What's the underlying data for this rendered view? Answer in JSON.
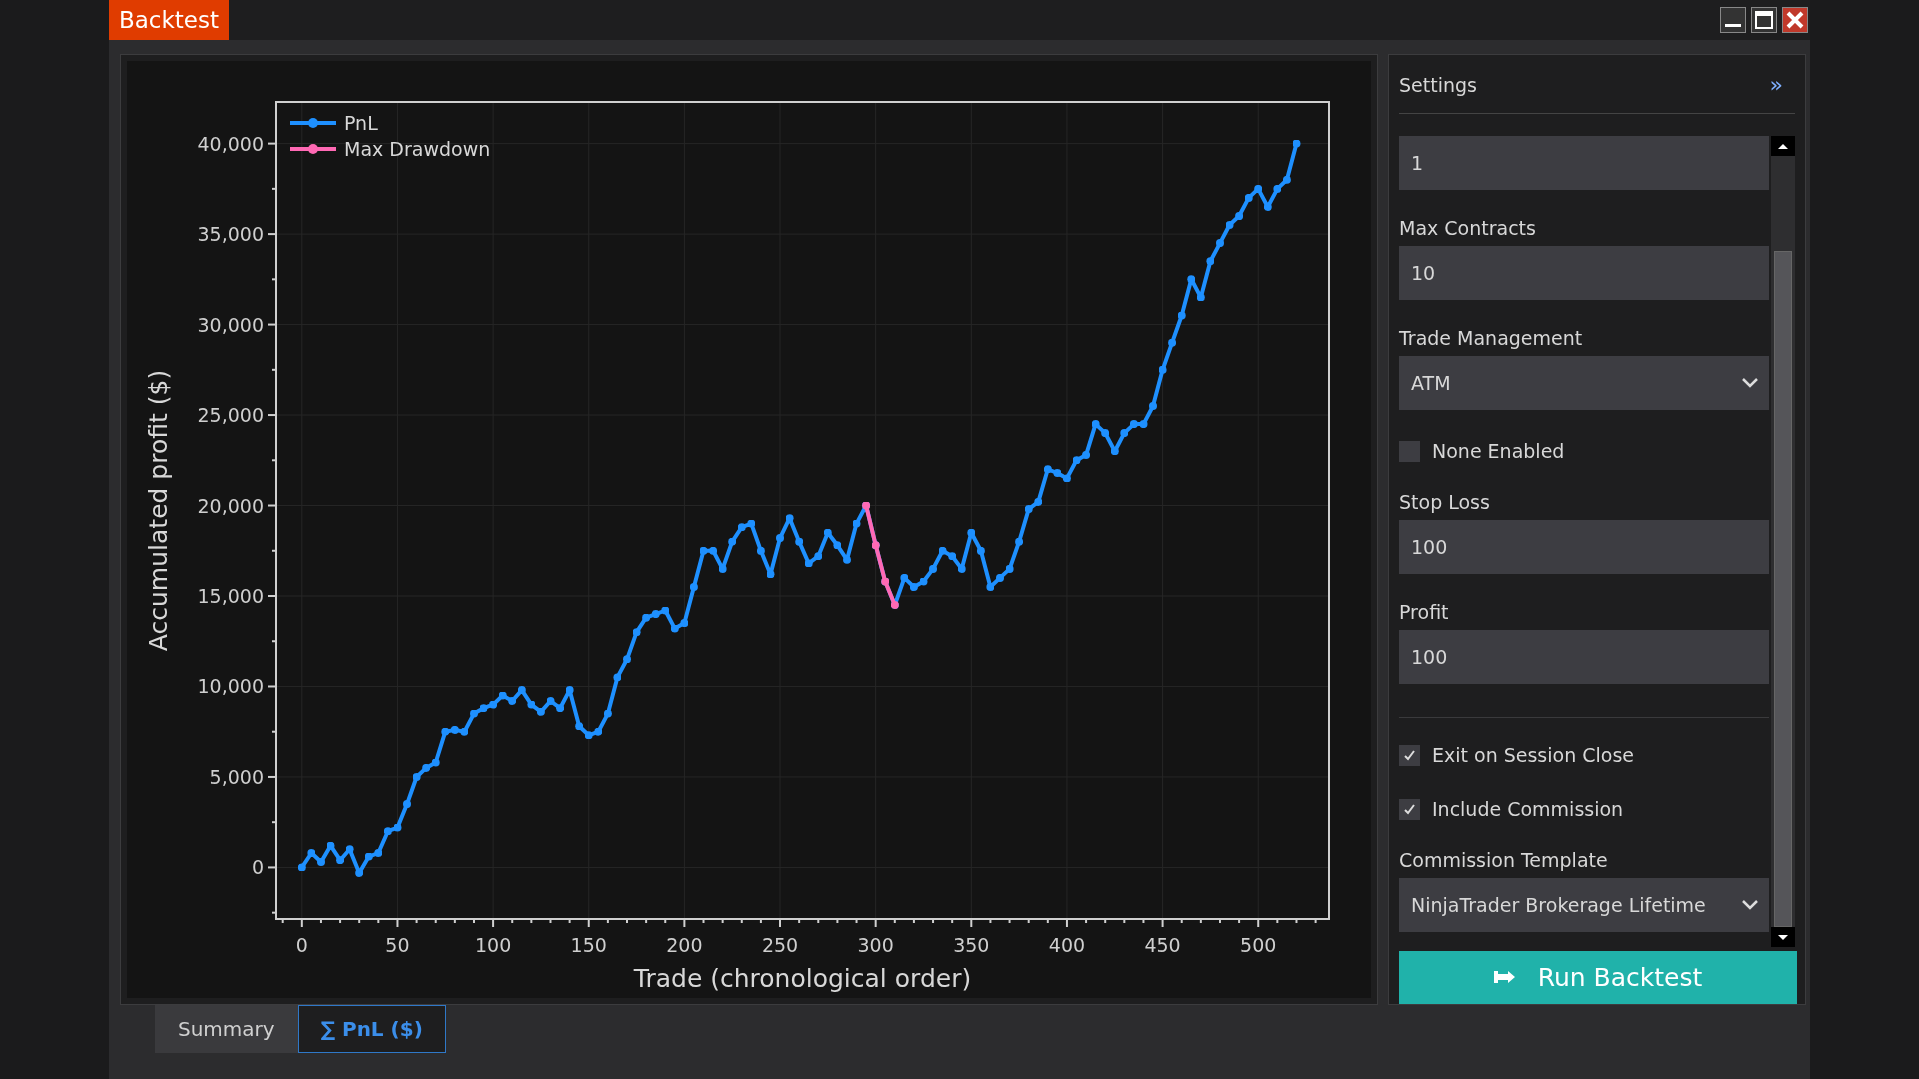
{
  "window": {
    "title": "Backtest"
  },
  "chart_panel": {
    "chart_data": {
      "type": "line",
      "grid": true,
      "legend": true,
      "xlabel": "Trade (chronological order)",
      "ylabel": "Accumulated profit ($)",
      "x": [
        0,
        5,
        10,
        15,
        20,
        25,
        30,
        35,
        40,
        45,
        50,
        55,
        60,
        65,
        70,
        75,
        80,
        85,
        90,
        95,
        100,
        105,
        110,
        115,
        120,
        125,
        130,
        135,
        140,
        145,
        150,
        155,
        160,
        165,
        170,
        175,
        180,
        185,
        190,
        195,
        200,
        205,
        210,
        215,
        220,
        225,
        230,
        235,
        240,
        245,
        250,
        255,
        260,
        265,
        270,
        275,
        280,
        285,
        290,
        295,
        300,
        305,
        310,
        315,
        320,
        325,
        330,
        335,
        340,
        345,
        350,
        355,
        360,
        365,
        370,
        375,
        380,
        385,
        390,
        395,
        400,
        405,
        410,
        415,
        420,
        425,
        430,
        435,
        440,
        445,
        450,
        455,
        460,
        465,
        470,
        475,
        480,
        485,
        490,
        495,
        500,
        505,
        510,
        515,
        520
      ],
      "series": [
        {
          "name": "PnL",
          "color": "#1e90ff",
          "values": [
            0,
            800,
            300,
            1200,
            400,
            1000,
            -300,
            600,
            800,
            2000,
            2200,
            3500,
            5000,
            5500,
            5800,
            7500,
            7600,
            7500,
            8500,
            8800,
            9000,
            9500,
            9200,
            9800,
            9000,
            8600,
            9200,
            8800,
            9800,
            7800,
            7300,
            7500,
            8500,
            10500,
            11500,
            13000,
            13800,
            14000,
            14200,
            13200,
            13500,
            15500,
            17500,
            17500,
            16500,
            18000,
            18800,
            19000,
            17500,
            16200,
            18200,
            19300,
            18000,
            16800,
            17200,
            18500,
            17800,
            17000,
            19000,
            20000,
            17800,
            15800,
            14500,
            16000,
            15500,
            15800,
            16500,
            17500,
            17200,
            16500,
            18500,
            17500,
            15500,
            16000,
            16500,
            18000,
            19800,
            20200,
            22000,
            21800,
            21500,
            22500,
            22800,
            24500,
            24000,
            23000,
            24000,
            24500,
            24500,
            25500,
            27500,
            29000,
            30500,
            32500,
            31500,
            33500,
            34500,
            35500,
            36000,
            37000,
            37500,
            36500,
            37500,
            38000,
            40000
          ]
        },
        {
          "name": "Max Drawdown",
          "color": "#ff69b4",
          "values": [
            null,
            null,
            null,
            null,
            null,
            null,
            null,
            null,
            null,
            null,
            null,
            null,
            null,
            null,
            null,
            null,
            null,
            null,
            null,
            null,
            null,
            null,
            null,
            null,
            null,
            null,
            null,
            null,
            null,
            null,
            null,
            null,
            null,
            null,
            null,
            null,
            null,
            null,
            null,
            null,
            null,
            null,
            null,
            null,
            null,
            null,
            null,
            null,
            null,
            null,
            null,
            null,
            null,
            null,
            null,
            null,
            null,
            null,
            null,
            20000,
            17800,
            15800,
            14500,
            null,
            null,
            null,
            null,
            null,
            null,
            null,
            null,
            null,
            null,
            null,
            null,
            null,
            null,
            null,
            null,
            null,
            null,
            null,
            null,
            null,
            null,
            null,
            null,
            null,
            null,
            null,
            null,
            null,
            null,
            null,
            null,
            null,
            null,
            null,
            null,
            null,
            null,
            null,
            null,
            null,
            null
          ]
        }
      ],
      "xlim": [
        -13.5,
        537
      ],
      "ylim": [
        -2850,
        42300
      ],
      "xticks": [
        0,
        50,
        100,
        150,
        200,
        250,
        300,
        350,
        400,
        450,
        500
      ],
      "yticks": [
        {
          "value": 0,
          "label": "0"
        },
        {
          "value": 5000,
          "label": "5,000"
        },
        {
          "value": 10000,
          "label": "10,000"
        },
        {
          "value": 15000,
          "label": "15,000"
        },
        {
          "value": 20000,
          "label": "20,000"
        },
        {
          "value": 25000,
          "label": "25,000"
        },
        {
          "value": 30000,
          "label": "30,000"
        },
        {
          "value": 35000,
          "label": "35,000"
        },
        {
          "value": 40000,
          "label": "40,000"
        }
      ]
    }
  },
  "settings": {
    "title": "Settings",
    "collapse_glyph": "»",
    "fields": [
      {
        "kind": "input",
        "value": "1"
      },
      {
        "kind": "input",
        "label": "Max Contracts",
        "value": "10"
      },
      {
        "kind": "select",
        "label": "Trade Management",
        "value": "ATM"
      },
      {
        "kind": "checkbox",
        "label": "None Enabled",
        "checked": false
      },
      {
        "kind": "input",
        "label": "Stop Loss",
        "value": "100"
      },
      {
        "kind": "input",
        "label": "Profit",
        "value": "100"
      },
      {
        "kind": "checkbox",
        "label": "Exit on Session Close",
        "checked": true,
        "divider_before": true
      },
      {
        "kind": "checkbox",
        "label": "Include Commission",
        "checked": true
      },
      {
        "kind": "select",
        "label": "Commission Template",
        "value": "NinjaTrader Brokerage Lifetime"
      }
    ],
    "run_button": "Run Backtest"
  },
  "tabs": [
    {
      "label": "Summary",
      "selected": false
    },
    {
      "label": "∑ PnL ($)",
      "selected": true
    }
  ]
}
